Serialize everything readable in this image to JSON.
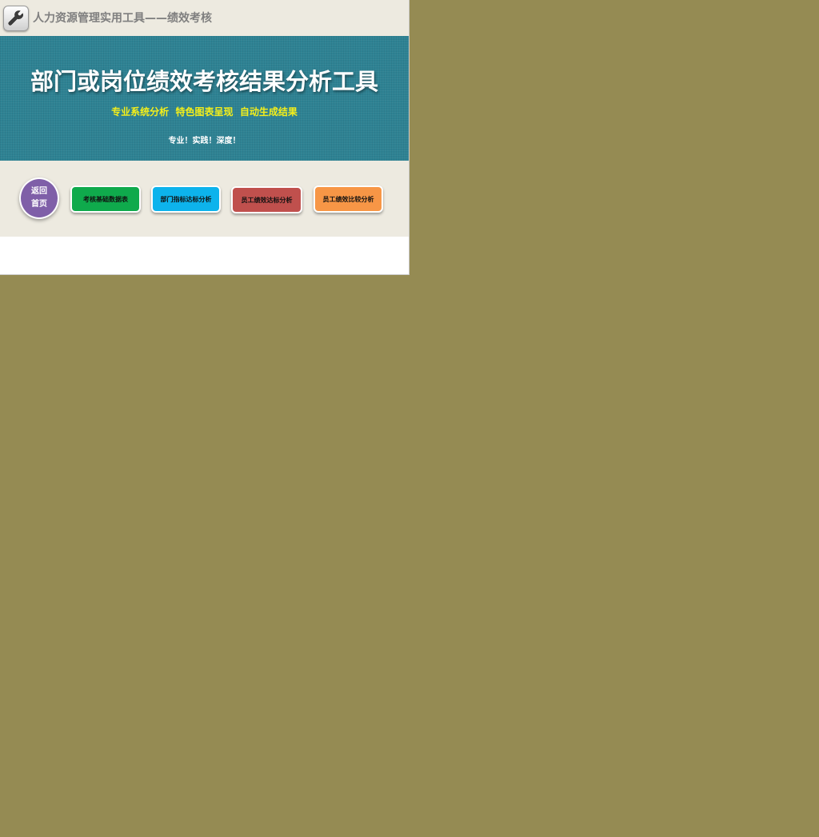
{
  "header": {
    "app_title": "人力资源管理实用工具——绩效考核",
    "icon": "wrench-icon"
  },
  "banner": {
    "title": "部门或岗位绩效考核结果分析工具",
    "tagline": "专业系统分析  特色图表呈现  自动生成结果",
    "motto": "专业！实践！深度！"
  },
  "nav": {
    "home_line1": "返回",
    "home_line2": "首页",
    "buttons": [
      {
        "label": "考核基础数据表",
        "color": "#0faa4c"
      },
      {
        "label": "部门指标达标分析",
        "color": "#0db3ec"
      },
      {
        "label": "员工绩效达标分析",
        "color": "#c0504d"
      },
      {
        "label": "员工绩效比较分析",
        "color": "#f79646"
      }
    ]
  },
  "colors": {
    "workspace_background": "#958b53",
    "banner_background": "#2e8293",
    "tagline": "#f5ef1a",
    "home_button": "#7f5fa8"
  }
}
